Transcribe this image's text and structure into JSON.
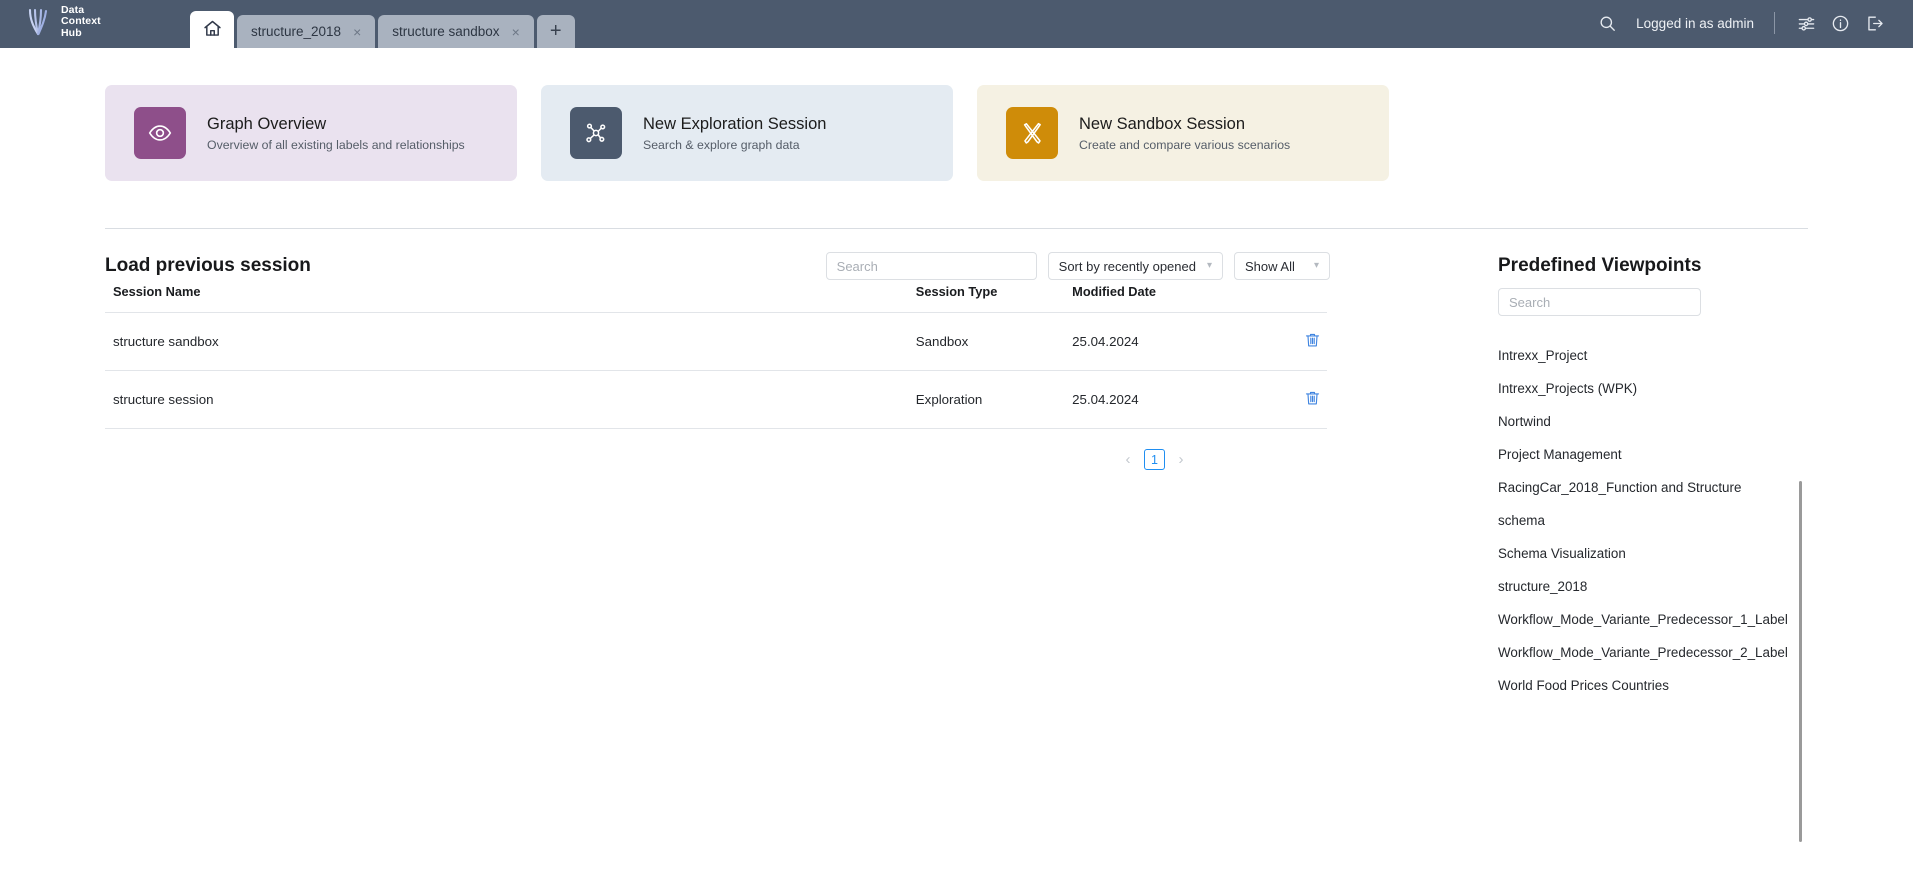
{
  "header": {
    "logo": {
      "icon": "data-context-hub-logo",
      "line1": "Data",
      "line2": "Context",
      "line3": "Hub"
    },
    "tabs": [
      {
        "id": "home",
        "label": "",
        "icon": "home-icon",
        "active": true,
        "closable": false
      },
      {
        "id": "structure_2018",
        "label": "structure_2018",
        "active": false,
        "closable": true
      },
      {
        "id": "structure_sandbox",
        "label": "structure sandbox",
        "active": false,
        "closable": true
      }
    ],
    "add_tab_label": "+",
    "close_glyph": "×",
    "search_icon": "search-icon",
    "user_status": "Logged in as admin",
    "settings_icon": "sliders-icon",
    "info_icon": "info-icon",
    "logout_icon": "logout-icon",
    "bg_color": "#4c5a6e"
  },
  "cards": [
    {
      "id": "graph-overview",
      "title": "Graph Overview",
      "subtitle": "Overview of all existing labels and relationships",
      "icon": "eye-icon",
      "icon_bg": "#8e4f8a",
      "card_bg": "#eae2ef"
    },
    {
      "id": "new-exploration-session",
      "title": "New Exploration Session",
      "subtitle": "Search & explore graph data",
      "icon": "graph-nodes-icon",
      "icon_bg": "#4c5a6e",
      "card_bg": "#e4ebf2"
    },
    {
      "id": "new-sandbox-session",
      "title": "New Sandbox Session",
      "subtitle": "Create and compare various scenarios",
      "icon": "design-tools-icon",
      "icon_bg": "#cf8c09",
      "card_bg": "#f5f1e3"
    }
  ],
  "sessions": {
    "title": "Load previous session",
    "search_placeholder": "Search",
    "search_value": "",
    "sort_label": "Sort by recently opened",
    "filter_label": "Show All",
    "columns": [
      "Session Name",
      "Session Type",
      "Modified Date",
      ""
    ],
    "rows": [
      {
        "name": "structure sandbox",
        "type": "Sandbox",
        "modified": "25.04.2024",
        "delete_icon": "trash-icon"
      },
      {
        "name": "structure session",
        "type": "Exploration",
        "modified": "25.04.2024",
        "delete_icon": "trash-icon"
      }
    ],
    "pagination": {
      "prev": "‹",
      "next": "›",
      "pages": [
        "1"
      ],
      "current": "1"
    }
  },
  "viewpoints": {
    "title": "Predefined Viewpoints",
    "search_placeholder": "Search",
    "search_value": "",
    "items": [
      "Intrexx_Project",
      "Intrexx_Projects (WPK)",
      "Nortwind",
      "Project Management",
      "RacingCar_2018_Function and Structure",
      "schema",
      "Schema Visualization",
      "structure_2018",
      "Workflow_Mode_Variante_Predecessor_1_Label",
      "Workflow_Mode_Variante_Predecessor_2_Label",
      "World Food Prices Countries"
    ]
  },
  "colors": {
    "header_bg": "#4c5a6e",
    "accent_blue": "#1f8ef1",
    "purple": "#8e4f8a",
    "gold": "#cf8c09"
  }
}
